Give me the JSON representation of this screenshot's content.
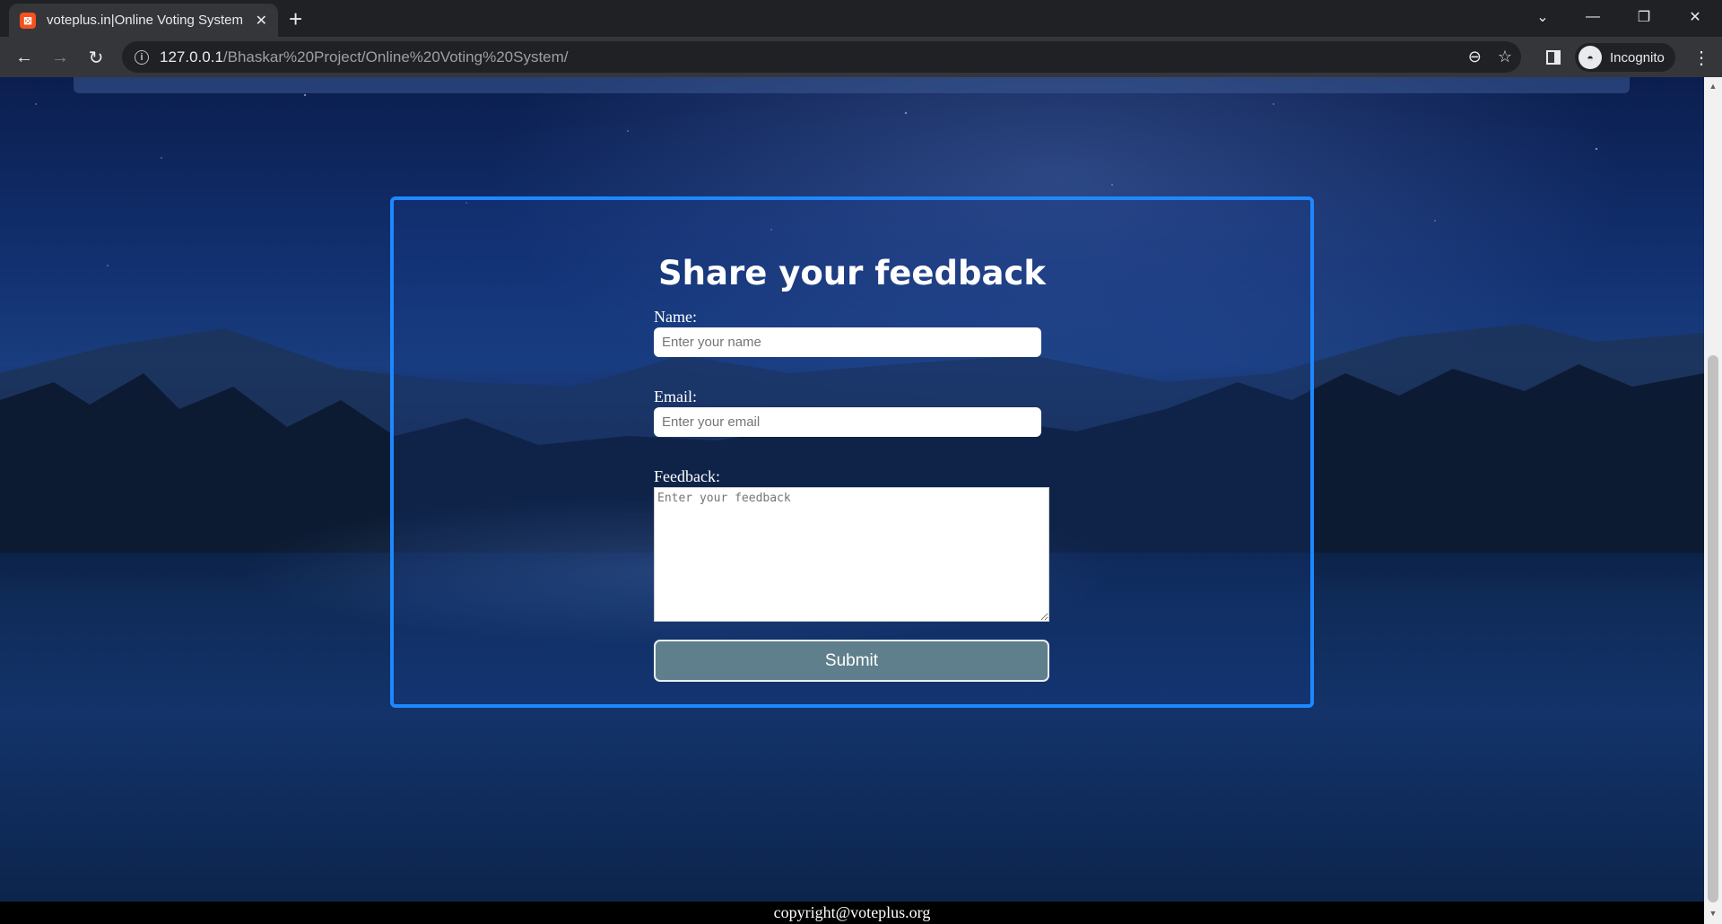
{
  "browser": {
    "tab_title": "voteplus.in|Online Voting System",
    "favicon_glyph": "⊠",
    "url_host": "127.0.0.1",
    "url_path": "/Bhaskar%20Project/Online%20Voting%20System/",
    "profile_label": "Incognito"
  },
  "form": {
    "title": "Share your feedback",
    "name_label": "Name:",
    "name_placeholder": "Enter your name",
    "email_label": "Email:",
    "email_placeholder": "Enter your email",
    "feedback_label": "Feedback:",
    "feedback_placeholder": "Enter your feedback",
    "submit_label": "Submit"
  },
  "footer": {
    "text": "copyright@voteplus.org"
  },
  "colors": {
    "card_border": "#1e88ff",
    "submit_bg": "#5f7f8c",
    "footer_bg": "#000000"
  }
}
